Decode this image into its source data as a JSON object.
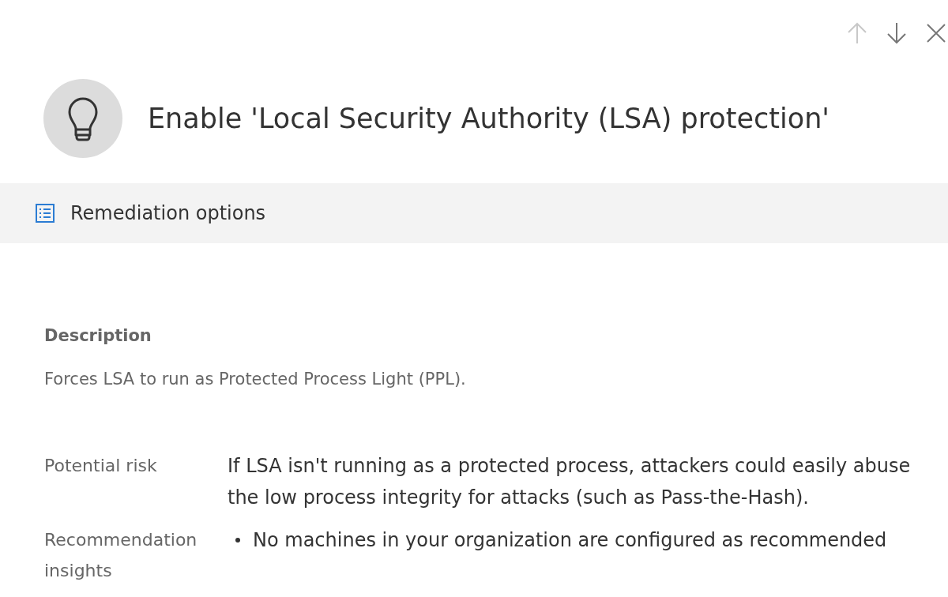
{
  "toolbar": [
    {
      "kind": "up",
      "disabled": true
    },
    {
      "kind": "down",
      "disabled": false
    },
    {
      "kind": "close",
      "disabled": false
    }
  ],
  "title": "Enable 'Local Security Authority (LSA) protection'",
  "command_bar": {
    "actions": [
      {
        "label": "Remediation options"
      }
    ]
  },
  "description": {
    "heading": "Description",
    "text": "Forces LSA to run as Protected Process Light (PPL)."
  },
  "details": [
    {
      "label": "Potential risk",
      "kind": "text",
      "value": "If LSA isn't running as a protected process, attackers could easily abuse the low process integrity for attacks (such as Pass-the-Hash)."
    },
    {
      "label": "Recommendation insights",
      "kind": "bullets",
      "items": [
        "No machines in your organization are configured as recommended"
      ]
    }
  ]
}
